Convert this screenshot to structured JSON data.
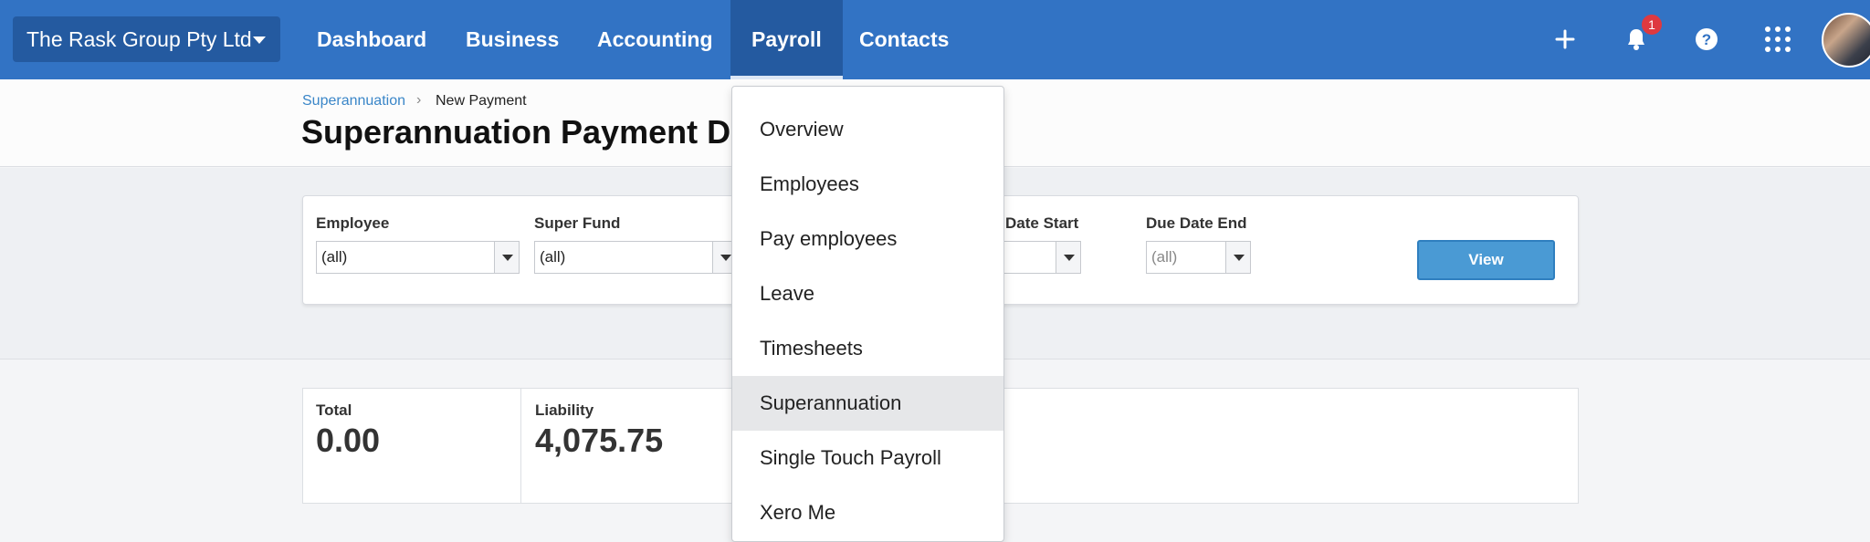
{
  "topnav": {
    "org_name": "The Rask Group Pty Ltd",
    "items": [
      {
        "label": "Dashboard"
      },
      {
        "label": "Business"
      },
      {
        "label": "Accounting"
      },
      {
        "label": "Payroll",
        "active": true
      },
      {
        "label": "Contacts"
      }
    ],
    "notification_count": "1",
    "icons": [
      "plus-icon",
      "bell-icon",
      "help-icon",
      "apps-grid-icon",
      "avatar"
    ]
  },
  "breadcrumb": {
    "parent": "Superannuation",
    "current": "New Payment"
  },
  "page": {
    "title": "Superannuation Payment De"
  },
  "filters": {
    "employee_label": "Employee",
    "employee_value": "(all)",
    "super_fund_label": "Super Fund",
    "super_fund_value": "(all)",
    "due_date_start_label": "Date Start",
    "due_date_start_value": "",
    "due_date_end_label": "Due Date End",
    "due_date_end_value": "(all)",
    "view_button": "View"
  },
  "totals": {
    "total_label": "Total",
    "total_value": "0.00",
    "liability_label": "Liability",
    "liability_value": "4,075.75"
  },
  "payroll_menu": {
    "items": [
      {
        "label": "Overview"
      },
      {
        "label": "Employees"
      },
      {
        "label": "Pay employees"
      },
      {
        "label": "Leave"
      },
      {
        "label": "Timesheets"
      },
      {
        "label": "Superannuation",
        "highlighted": true
      },
      {
        "label": "Single Touch Payroll"
      },
      {
        "label": "Xero Me"
      }
    ]
  },
  "colors": {
    "nav_blue": "#3273c4",
    "nav_active": "#245aa0",
    "button_blue": "#4a9ad4",
    "badge_red": "#de3940"
  }
}
